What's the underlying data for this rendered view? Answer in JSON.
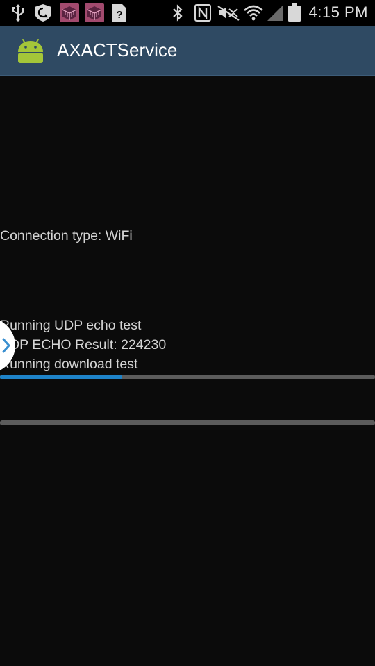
{
  "status_bar": {
    "time": "4:15 PM",
    "icons": [
      "usb-icon",
      "shield-icon",
      "app-notification-icon",
      "app-notification-icon",
      "unknown-notification-icon",
      "bluetooth-icon",
      "nfc-icon",
      "mute-icon",
      "wifi-icon",
      "signal-icon",
      "battery-icon"
    ]
  },
  "action_bar": {
    "title": "AXACTService",
    "icon": "android-icon",
    "background": "#2f4a63"
  },
  "content": {
    "connection_type": "Connection type: WiFi",
    "lines": [
      "Running UDP echo test",
      "UDP ECHO Result: 224230",
      "Running download test"
    ],
    "progress_download": 0.325,
    "progress_second": 0,
    "accent_color": "#1e83c8"
  }
}
